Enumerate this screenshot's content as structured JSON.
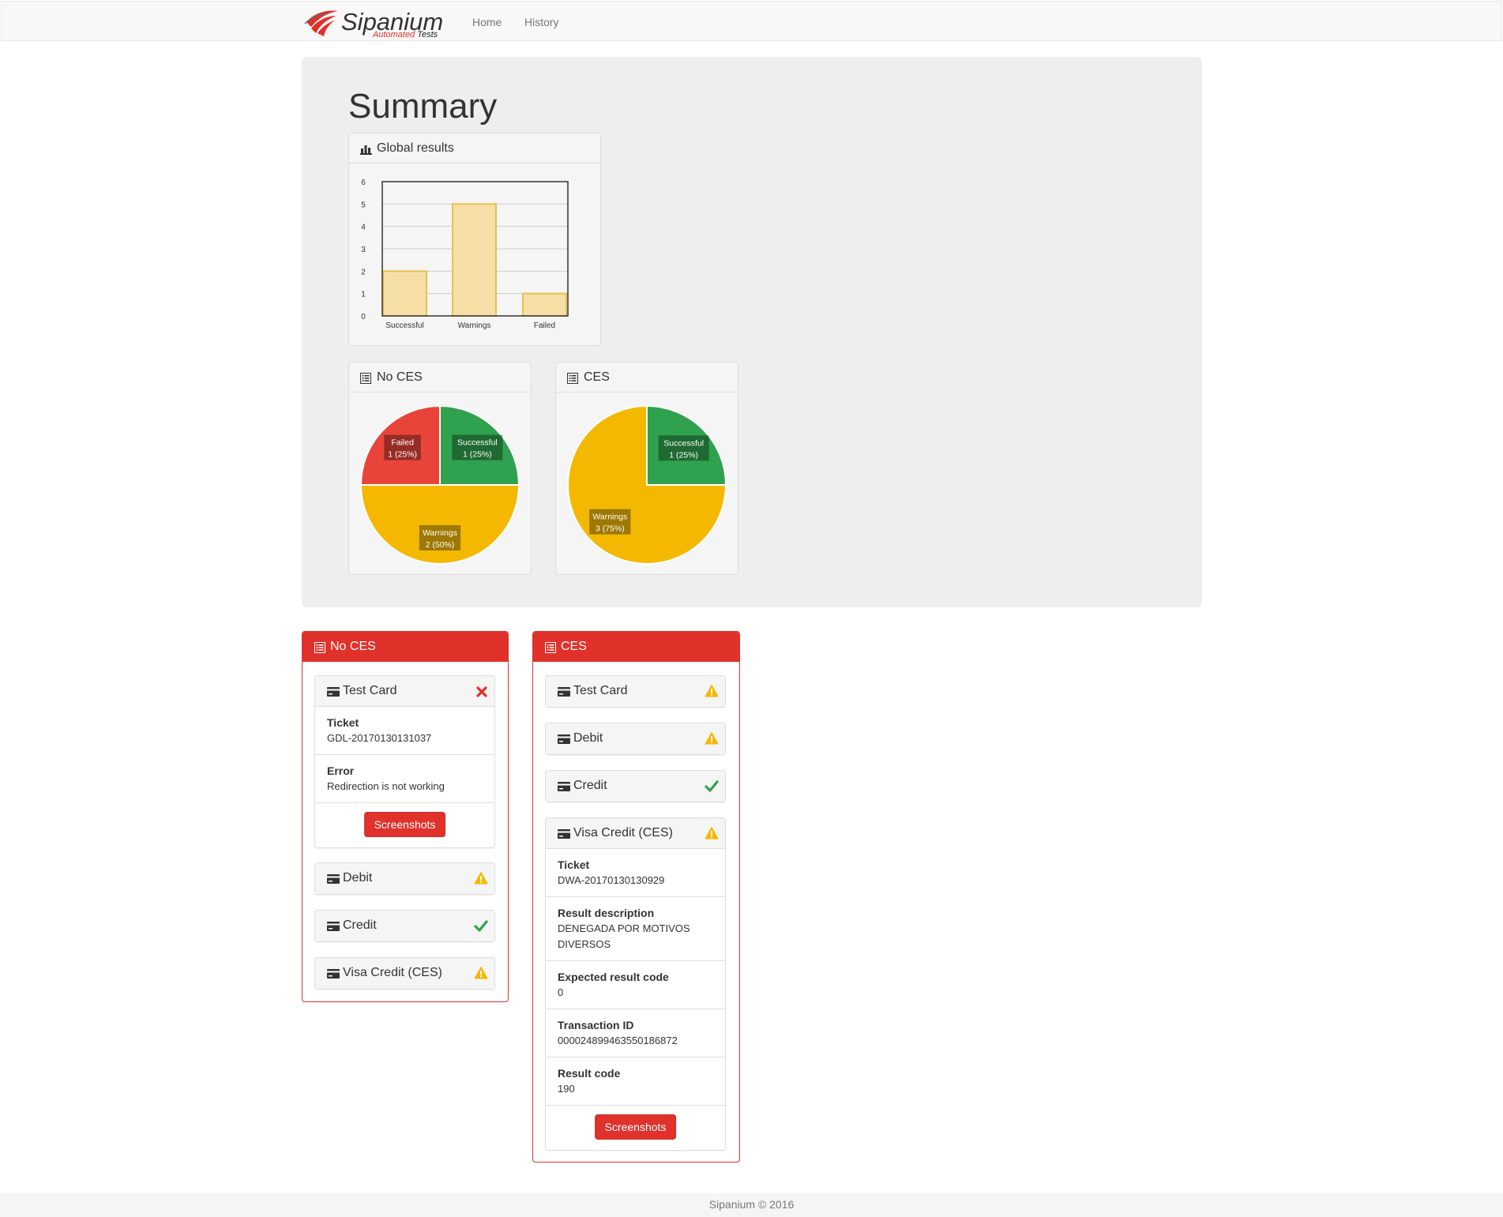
{
  "navbar": {
    "brand_name": "Sipanium",
    "brand_sub_red": "Automated",
    "brand_sub_black": "Tests",
    "links": [
      "Home",
      "History"
    ]
  },
  "summary": {
    "title": "Summary",
    "global_panel_title": "Global results",
    "nocs_panel_title": "No CES",
    "ces_panel_title": "CES"
  },
  "colors": {
    "successful": "#30a14e",
    "warnings": "#f5b800",
    "failed": "#e8443a",
    "bar_fill": "#f5dfa6",
    "bar_stroke": "#e9c04c",
    "accent_red": "#e0312a"
  },
  "chart_data": [
    {
      "type": "bar",
      "title": "Global results",
      "categories": [
        "Successful",
        "Warnings",
        "Failed"
      ],
      "values": [
        2,
        5,
        1
      ],
      "ylim": [
        0,
        6
      ],
      "yticks": [
        0,
        1,
        2,
        3,
        4,
        5,
        6
      ],
      "grid": true
    },
    {
      "type": "pie",
      "title": "No CES",
      "slices": [
        {
          "label": "Successful",
          "value": 1,
          "pct": "25%",
          "color": "#30a14e"
        },
        {
          "label": "Warnings",
          "value": 2,
          "pct": "50%",
          "color": "#f5b800"
        },
        {
          "label": "Failed",
          "value": 1,
          "pct": "25%",
          "color": "#e8443a"
        }
      ]
    },
    {
      "type": "pie",
      "title": "CES",
      "slices": [
        {
          "label": "Successful",
          "value": 1,
          "pct": "25%",
          "color": "#30a14e"
        },
        {
          "label": "Warnings",
          "value": 3,
          "pct": "75%",
          "color": "#f5b800"
        }
      ]
    }
  ],
  "nocs": {
    "title": "No CES",
    "cards": [
      {
        "name": "Test Card",
        "status": "failed",
        "rows": [
          {
            "label": "Ticket",
            "value": "GDL-20170130131037"
          },
          {
            "label": "Error",
            "value": "Redirection is not working"
          }
        ],
        "button": "Screenshots"
      },
      {
        "name": "Debit",
        "status": "warning"
      },
      {
        "name": "Credit",
        "status": "success"
      },
      {
        "name": "Visa Credit (CES)",
        "status": "warning"
      }
    ]
  },
  "ces": {
    "title": "CES",
    "cards": [
      {
        "name": "Test Card",
        "status": "warning"
      },
      {
        "name": "Debit",
        "status": "warning"
      },
      {
        "name": "Credit",
        "status": "success"
      },
      {
        "name": "Visa Credit (CES)",
        "status": "warning",
        "rows": [
          {
            "label": "Ticket",
            "value": "DWA-20170130130929"
          },
          {
            "label": "Result description",
            "value": "DENEGADA POR MOTIVOS DIVERSOS"
          },
          {
            "label": "Expected result code",
            "value": "0"
          },
          {
            "label": "Transaction ID",
            "value": "000024899463550186872"
          },
          {
            "label": "Result code",
            "value": "190"
          }
        ],
        "button": "Screenshots"
      }
    ]
  },
  "footer": {
    "text": "Sipanium © 2016"
  }
}
